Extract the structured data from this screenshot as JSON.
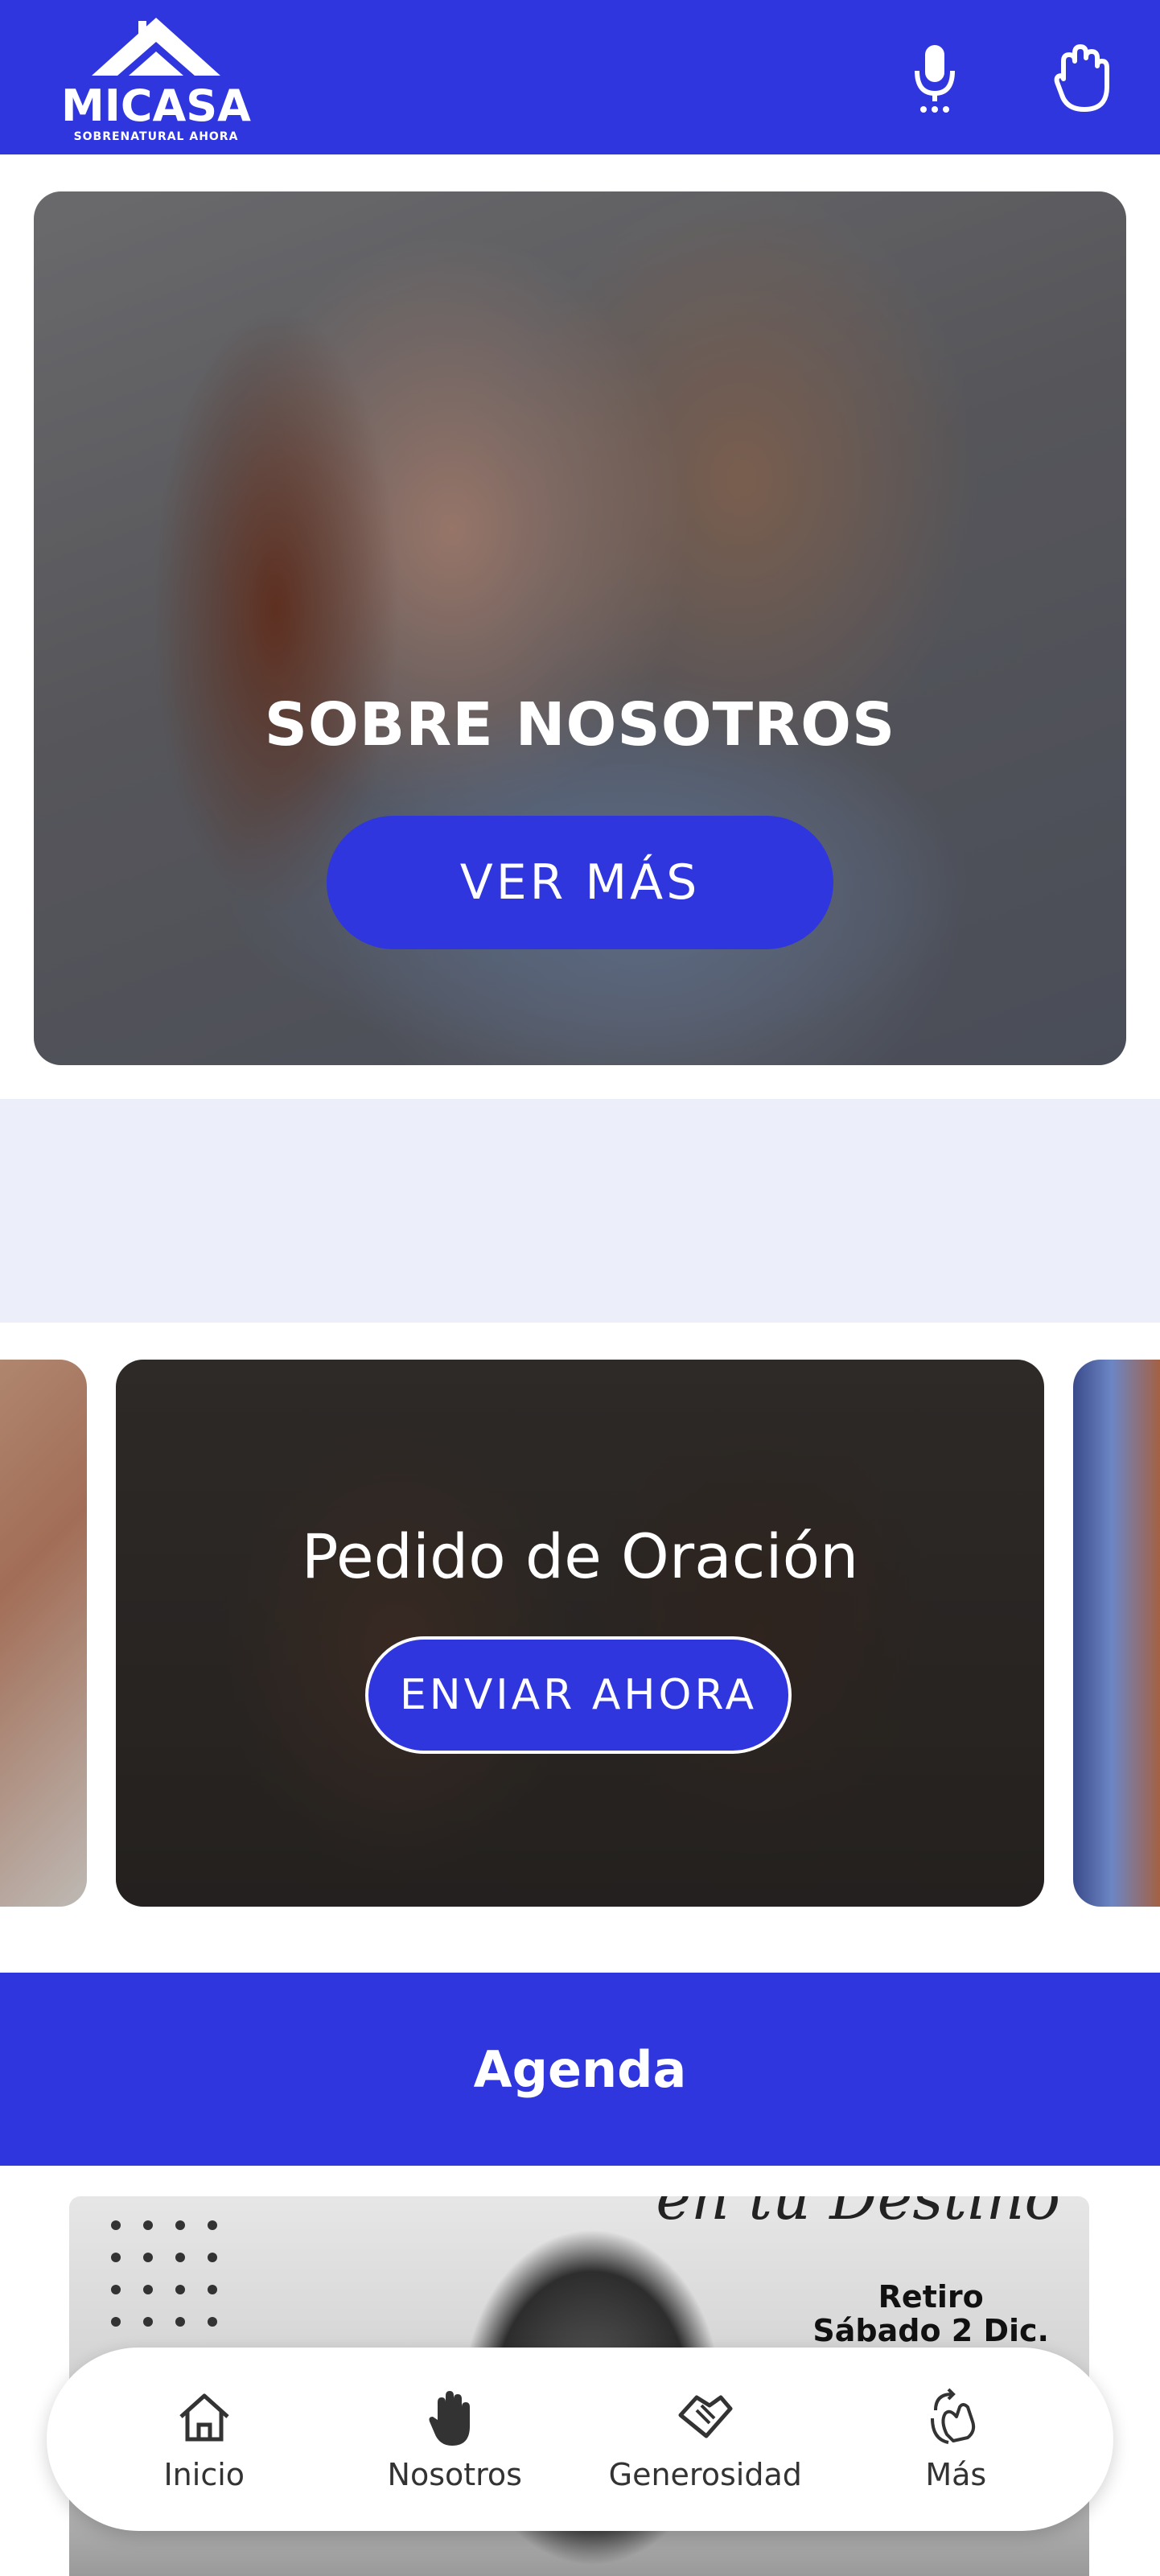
{
  "header": {
    "logo_text": "MICASA",
    "logo_subtext": "SOBRENATURAL AHORA",
    "icons": [
      "microphone-icon",
      "praying-hand-icon"
    ]
  },
  "hero": {
    "title": "SOBRE NOSOTROS",
    "button_label": "VER MÁS",
    "slides": 2,
    "active_slide": 1
  },
  "cards": {
    "main_title": "Pedido de Oración",
    "main_button": "ENVIAR AHORA"
  },
  "agenda": {
    "title": "Agenda",
    "event_script": "en tu Destino",
    "event_line1": "Retiro",
    "event_line2": "Sábado 2 Dic."
  },
  "bottom_nav": {
    "items": [
      {
        "label": "Inicio",
        "icon": "home-icon"
      },
      {
        "label": "Nosotros",
        "icon": "hand-icon"
      },
      {
        "label": "Generosidad",
        "icon": "handshake-icon"
      },
      {
        "label": "Más",
        "icon": "more-icon"
      }
    ]
  },
  "colors": {
    "brand_blue": "#2f36de",
    "band": "#eceef9"
  }
}
